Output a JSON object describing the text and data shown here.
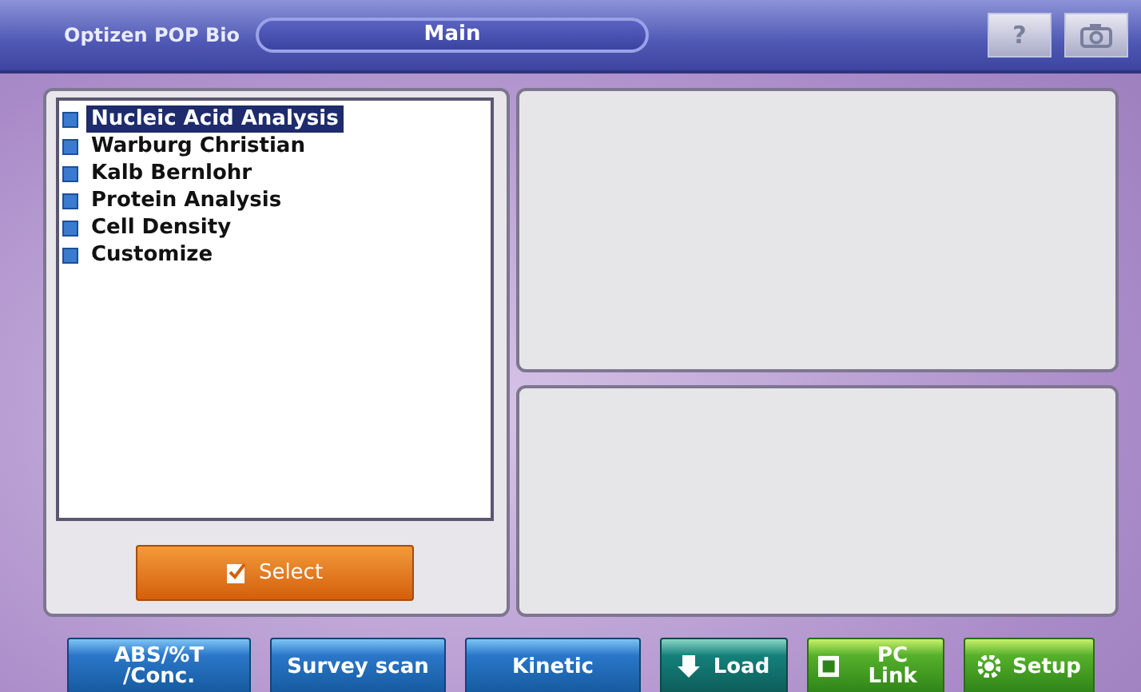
{
  "header": {
    "app_name": "Optizen POP Bio",
    "screen_title": "Main",
    "help_button": "?"
  },
  "methods": [
    {
      "label": "Nucleic Acid Analysis",
      "selected": true
    },
    {
      "label": "Warburg Christian",
      "selected": false
    },
    {
      "label": "Kalb Bernlohr",
      "selected": false
    },
    {
      "label": "Protein Analysis",
      "selected": false
    },
    {
      "label": "Cell Density",
      "selected": false
    },
    {
      "label": "Customize",
      "selected": false
    }
  ],
  "select_button": "Select",
  "bottom_buttons": [
    {
      "label": "ABS/%T /Conc.",
      "kind": "mode"
    },
    {
      "label": "Survey scan",
      "kind": "mode"
    },
    {
      "label": "Kinetic",
      "kind": "mode"
    },
    {
      "label": "Load",
      "kind": "load"
    },
    {
      "label": "PC Link",
      "kind": "link"
    },
    {
      "label": "Setup",
      "kind": "setup"
    }
  ]
}
